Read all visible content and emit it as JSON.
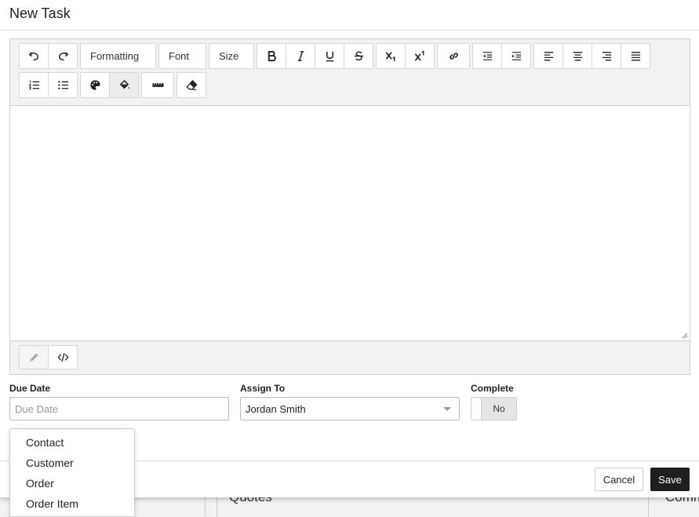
{
  "modal": {
    "title": "New Task"
  },
  "toolbar": {
    "formatting_label": "Formatting",
    "font_label": "Font",
    "size_label": "Size",
    "icons": [
      "undo-icon",
      "redo-icon",
      "bold-icon",
      "italic-icon",
      "underline-icon",
      "strikethrough-icon",
      "subscript-icon",
      "superscript-icon",
      "link-icon",
      "outdent-icon",
      "indent-icon",
      "align-left-icon",
      "align-center-icon",
      "align-right-icon",
      "align-justify-icon",
      "ordered-list-icon",
      "unordered-list-icon",
      "text-color-icon",
      "background-color-icon",
      "horizontal-rule-icon",
      "remove-format-icon"
    ]
  },
  "status_bar": {
    "icons": [
      "pencil-icon",
      "code-view-icon"
    ]
  },
  "fields": {
    "due_date": {
      "label": "Due Date",
      "placeholder": "Due Date",
      "value": ""
    },
    "assign_to": {
      "label": "Assign To",
      "value": "Jordan Smith"
    },
    "complete": {
      "label": "Complete",
      "value": "No"
    }
  },
  "dropdown": {
    "options": [
      "Contact",
      "Customer",
      "Order",
      "Order Item"
    ]
  },
  "footer": {
    "cancel_label": "Cancel",
    "save_label": "Save"
  },
  "background": {
    "left_heading": "Quotes",
    "right_heading": "Comm"
  },
  "colors": {
    "primary_button": "#1f1f1f",
    "toolbar_bg": "#f2f2f2"
  }
}
